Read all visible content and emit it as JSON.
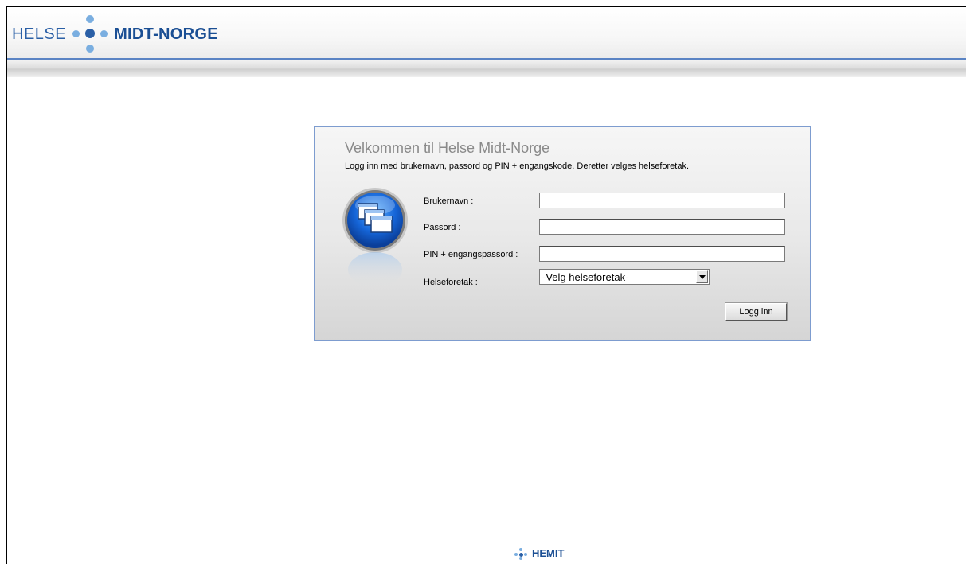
{
  "header": {
    "logo_left": "HELSE",
    "logo_right": "MIDT-NORGE"
  },
  "login": {
    "title": "Velkommen til Helse Midt-Norge",
    "subtitle": "Logg inn med brukernavn, passord og PIN + engangskode. Deretter velges helseforetak.",
    "fields": {
      "username_label": "Brukernavn :",
      "username_value": "",
      "password_label": "Passord :",
      "password_value": "",
      "pin_label": "PIN + engangspassord :",
      "pin_value": "",
      "hf_label": "Helseforetak :",
      "hf_selected": "-Velg helseforetak-"
    },
    "submit_label": "Logg inn"
  },
  "footer": {
    "logo_text": "HEMIT"
  },
  "colors": {
    "brand_blue": "#1b4f94",
    "accent_blue": "#5b84c4",
    "dot_blue": "#7aaee0"
  },
  "icons": {
    "logo_dots": "helse-midt-norge-dots-icon",
    "app_icon": "windows-stack-icon",
    "dropdown_arrow": "chevron-down-icon"
  }
}
